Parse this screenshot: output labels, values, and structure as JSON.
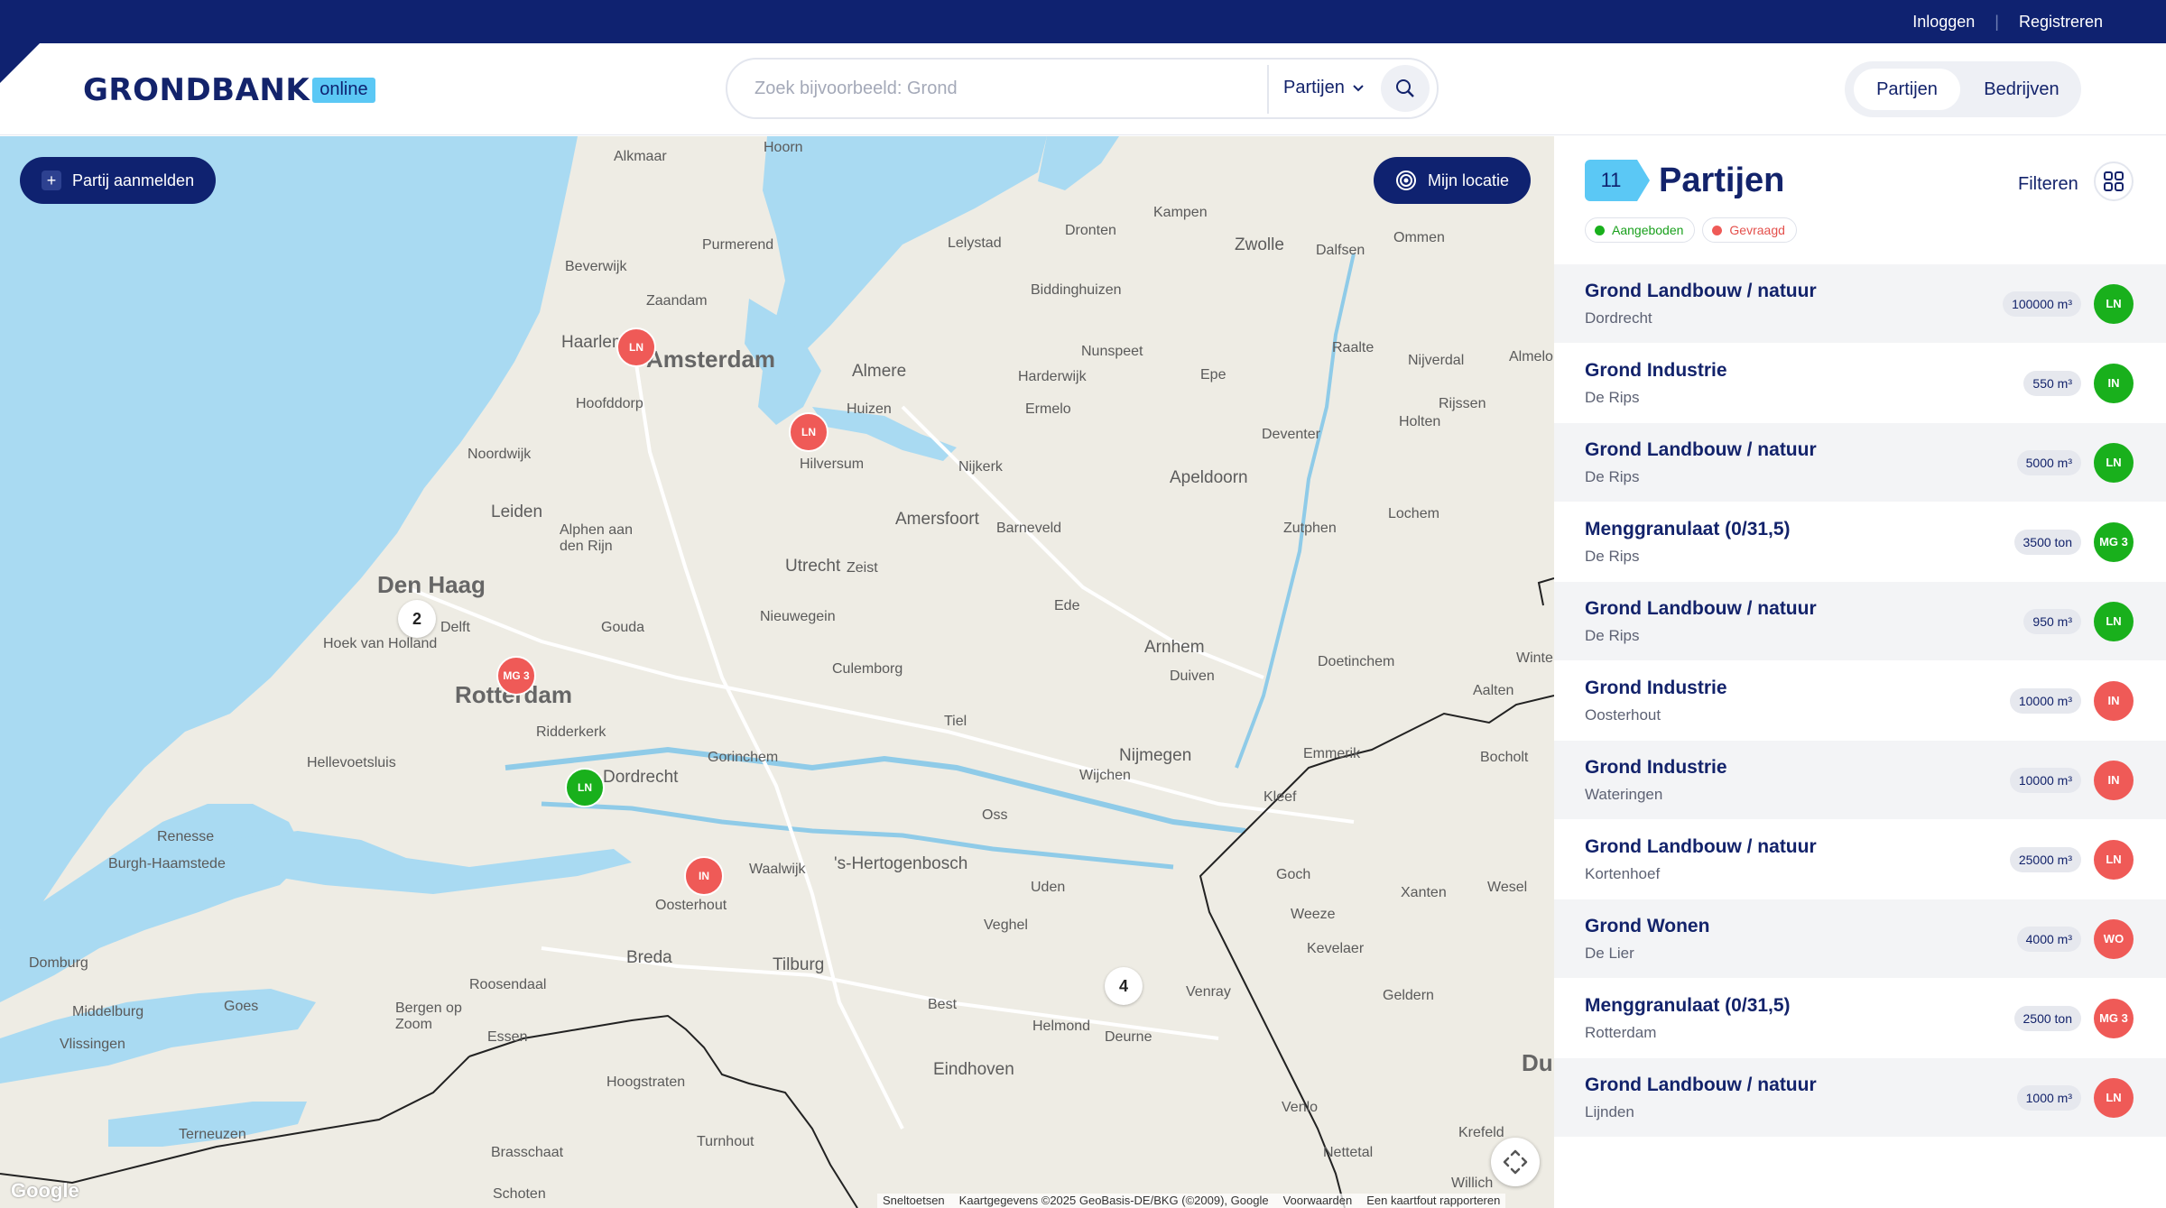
{
  "topbar": {
    "login": "Inloggen",
    "separator": "|",
    "register": "Registreren"
  },
  "logo": {
    "word": "GRONDBANK",
    "tag": "online"
  },
  "search": {
    "placeholder": "Zoek bijvoorbeeld: Grond",
    "scope": "Partijen"
  },
  "view_toggle": {
    "active": "Partijen",
    "inactive": "Bedrijven"
  },
  "map": {
    "add_button": "Partij aanmelden",
    "location_button": "Mijn locatie",
    "places": {
      "amsterdam": "Amsterdam",
      "den_haag": "Den Haag",
      "rotterdam": "Rotterdam",
      "utrecht": "Utrecht",
      "haarlem": "Haarlem",
      "leiden": "Leiden",
      "almere": "Almere",
      "amersfoort": "Amersfoort",
      "apeldoorn": "Apeldoorn",
      "arnhem": "Arnhem",
      "nijmegen": "Nijmegen",
      "hertogenbosch": "'s-Hertogenbosch",
      "tilburg": "Tilburg",
      "breda": "Breda",
      "eindhoven": "Eindhoven",
      "zwolle": "Zwolle",
      "hilversum": "Hilversum",
      "gouda": "Gouda",
      "delft": "Delft",
      "dordrecht": "Dordrecht",
      "lelystad": "Lelystad",
      "dronten": "Dronten",
      "kampen": "Kampen",
      "zaandam": "Zaandam",
      "purmerend": "Purmerend",
      "hoorn": "Hoorn",
      "alkmaar": "Alkmaar",
      "beverwijk": "Beverwijk",
      "ede": "Ede",
      "oss": "Oss",
      "uden": "Uden",
      "venlo": "Venlo",
      "helmond": "Helmond",
      "roosendaal": "Roosendaal",
      "middelburg": "Middelburg",
      "vlissingen": "Vlissingen",
      "oosterhout": "Oosterhout",
      "waalwijk": "Waalwijk",
      "gorinchem": "Gorinchem",
      "hellevoetsluis": "Hellevoetsluis",
      "hoek": "Hoek van Holland",
      "deventer": "Deventer",
      "zutphen": "Zutphen",
      "doetinchem": "Doetinchem",
      "nieuwegein": "Nieuwegein",
      "culemborg": "Culemborg",
      "tiel": "Tiel",
      "veenendaal": "Barneveld",
      "nijkerk": "Nijkerk",
      "ermelo": "Ermelo",
      "harderwijk": "Harderwijk",
      "nunspeet": "Nunspeet",
      "epe": "Epe",
      "raalte": "Raalte",
      "dalfsen": "Dalfsen",
      "ommen": "Ommen",
      "nijverdal": "Nijverdal",
      "rijssen": "Rijssen",
      "holten": "Holten",
      "lochem": "Lochem",
      "duiven": "Duiven",
      "wijchen": "Wijchen",
      "kleef": "Kleef",
      "goch": "Goch",
      "weeze": "Weeze",
      "xanten": "Xanten",
      "wesel": "Wesel",
      "kevelaer": "Kevelaer",
      "geldern": "Geldern",
      "venray": "Venray",
      "deurne": "Deurne",
      "veghel": "Veghel",
      "best": "Best",
      "goes": "Goes",
      "domburg": "Domburg",
      "renesse": "Renesse",
      "burgh": "Burgh-Haamstede",
      "bergen": "Bergen op Zoom",
      "essen": "Essen",
      "hoogstraten": "Hoogstraten",
      "turnhout": "Turnhout",
      "brasschaat": "Brasschaat",
      "terneuzen": "Terneuzen",
      "schoten": "Schoten",
      "nettetal": "Nettetal",
      "krefeld": "Krefeld",
      "willich": "Willich",
      "emmerik": "Emmerik",
      "bocholt": "Bocholt",
      "aalten": "Aalten",
      "hoofddorp": "Hoofddorp",
      "noordwijk": "Noordwijk",
      "alphen": "Alphen aan den Rijn",
      "zeist": "Zeist",
      "ridderkerk": "Ridderkerk",
      "huizen": "Huizen",
      "biddinghuizen": "Biddinghuizen",
      "du": "Du",
      "winte": "Winte",
      "almelo": "Almelo"
    },
    "markers": {
      "m1": "LN",
      "m2": "LN",
      "m3": "MG 3",
      "m4": "LN",
      "m5": "IN"
    },
    "clusters": {
      "c1": "2",
      "c2": "4"
    },
    "google": "Google",
    "attribution": {
      "shortcuts": "Sneltoetsen",
      "data": "Kaartgegevens ©2025 GeoBasis-DE/BKG (©2009), Google",
      "terms": "Voorwaarden",
      "report": "Een kaartfout rapporteren"
    }
  },
  "panel": {
    "count": "11",
    "title": "Partijen",
    "filter_label": "Filteren",
    "legend": {
      "offered": "Aangeboden",
      "requested": "Gevraagd"
    },
    "colors": {
      "offered": "#19b01c",
      "requested": "#ef5a57",
      "accent": "#5bc8f5",
      "navy": "#0f2270"
    },
    "items": [
      {
        "title": "Grond Landbouw / natuur",
        "location": "Dordrecht",
        "quantity": "100000 m³",
        "code": "LN",
        "status": "offered"
      },
      {
        "title": "Grond Industrie",
        "location": "De Rips",
        "quantity": "550 m³",
        "code": "IN",
        "status": "offered"
      },
      {
        "title": "Grond Landbouw / natuur",
        "location": "De Rips",
        "quantity": "5000 m³",
        "code": "LN",
        "status": "offered"
      },
      {
        "title": "Menggranulaat (0/31,5)",
        "location": "De Rips",
        "quantity": "3500 ton",
        "code": "MG 3",
        "status": "offered"
      },
      {
        "title": "Grond Landbouw / natuur",
        "location": "De Rips",
        "quantity": "950 m³",
        "code": "LN",
        "status": "offered"
      },
      {
        "title": "Grond Industrie",
        "location": "Oosterhout",
        "quantity": "10000 m³",
        "code": "IN",
        "status": "requested"
      },
      {
        "title": "Grond Industrie",
        "location": "Wateringen",
        "quantity": "10000 m³",
        "code": "IN",
        "status": "requested"
      },
      {
        "title": "Grond Landbouw / natuur",
        "location": "Kortenhoef",
        "quantity": "25000 m³",
        "code": "LN",
        "status": "requested"
      },
      {
        "title": "Grond Wonen",
        "location": "De Lier",
        "quantity": "4000 m³",
        "code": "WO",
        "status": "requested"
      },
      {
        "title": "Menggranulaat (0/31,5)",
        "location": "Rotterdam",
        "quantity": "2500 ton",
        "code": "MG 3",
        "status": "requested"
      },
      {
        "title": "Grond Landbouw / natuur",
        "location": "Lijnden",
        "quantity": "1000 m³",
        "code": "LN",
        "status": "requested"
      }
    ]
  }
}
